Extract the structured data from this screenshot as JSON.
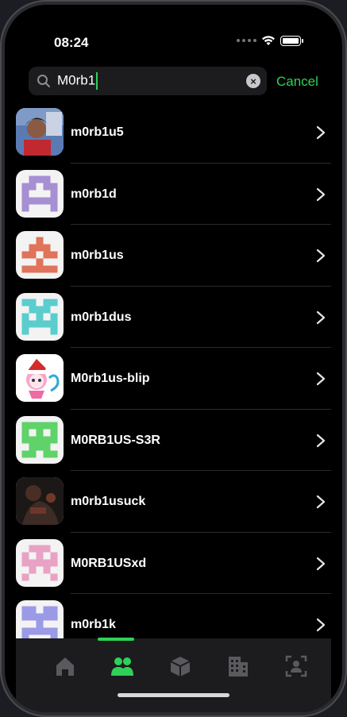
{
  "status": {
    "time": "08:24"
  },
  "search": {
    "query": "M0rb1",
    "cancel_label": "Cancel"
  },
  "results": [
    {
      "name": "m0rb1u5",
      "avatar": "photo",
      "color": "#4a6fa5"
    },
    {
      "name": "m0rb1d",
      "avatar": "invader-a",
      "color": "#a68fd2"
    },
    {
      "name": "m0rb1us",
      "avatar": "invader-b",
      "color": "#e0735a"
    },
    {
      "name": "m0rb1dus",
      "avatar": "invader-c",
      "color": "#5bcdcd"
    },
    {
      "name": "M0rb1us-blip",
      "avatar": "cartoon",
      "color": "#f06aa5"
    },
    {
      "name": "M0RB1US-S3R",
      "avatar": "invader-d",
      "color": "#5fd26a"
    },
    {
      "name": "m0rb1usuck",
      "avatar": "photo-dark",
      "color": "#3a3030"
    },
    {
      "name": "M0RB1USxd",
      "avatar": "invader-e",
      "color": "#e8a2c4"
    },
    {
      "name": "m0rb1k",
      "avatar": "invader-f",
      "color": "#9a9ae6"
    }
  ],
  "tabbar": {
    "items": [
      {
        "icon": "home-icon",
        "active": false
      },
      {
        "icon": "people-icon",
        "active": true
      },
      {
        "icon": "box-icon",
        "active": false
      },
      {
        "icon": "building-icon",
        "active": false
      },
      {
        "icon": "profile-scan-icon",
        "active": false
      }
    ],
    "active_color": "#2ed158",
    "inactive_color": "#5a5a5e"
  }
}
